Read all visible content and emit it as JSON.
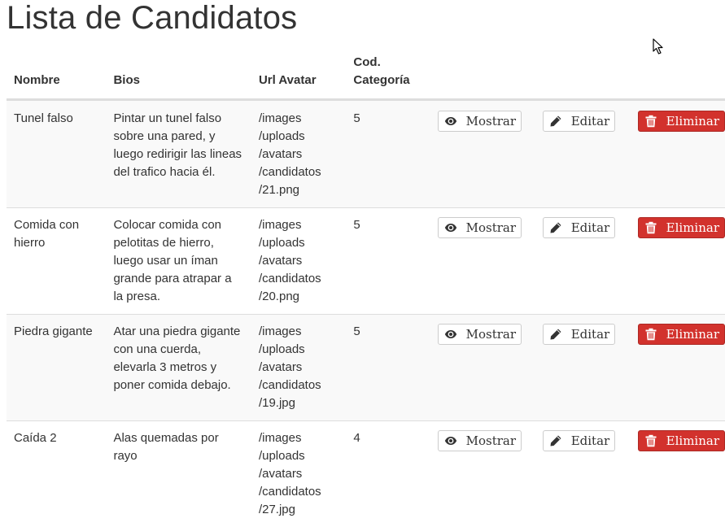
{
  "page": {
    "title": "Lista de Candidatos"
  },
  "table": {
    "headers": {
      "nombre": "Nombre",
      "bios": "Bios",
      "url_avatar": "Url Avatar",
      "cod_categoria_line1": "Cod.",
      "cod_categoria_line2": "Categoría"
    },
    "rows": [
      {
        "nombre": "Tunel falso",
        "bios": "Pintar un tunel falso sobre una pared, y luego redirigir las lineas del trafico hacia él.",
        "url_parts": [
          "/images",
          "/uploads",
          "/avatars",
          "/candidatos",
          "/21.png"
        ],
        "cod_categoria": "5"
      },
      {
        "nombre": "Comida con hierro",
        "bios": "Colocar comida con pelotitas de hierro, luego usar un íman grande para atrapar a la presa.",
        "url_parts": [
          "/images",
          "/uploads",
          "/avatars",
          "/candidatos",
          "/20.png"
        ],
        "cod_categoria": "5"
      },
      {
        "nombre": "Piedra gigante",
        "bios": "Atar una piedra gigante con una cuerda, elevarla 3 metros y poner comida debajo.",
        "url_parts": [
          "/images",
          "/uploads",
          "/avatars",
          "/candidatos",
          "/19.jpg"
        ],
        "cod_categoria": "5"
      },
      {
        "nombre": "Caída 2",
        "bios": "Alas quemadas por rayo",
        "url_parts": [
          "/images",
          "/uploads",
          "/avatars",
          "/candidatos",
          "/27.jpg"
        ],
        "cod_categoria": "4"
      }
    ]
  },
  "actions": {
    "show_label": "Mostrar",
    "edit_label": "Editar",
    "delete_label": "Eliminar",
    "show_icon": "eye-icon",
    "edit_icon": "pencil-icon",
    "delete_icon": "trash-icon"
  },
  "colors": {
    "danger": "#d2322d",
    "danger_border": "#ac2925",
    "text": "#333333",
    "row_stripe": "#f9f9f9",
    "border": "#dddddd"
  }
}
